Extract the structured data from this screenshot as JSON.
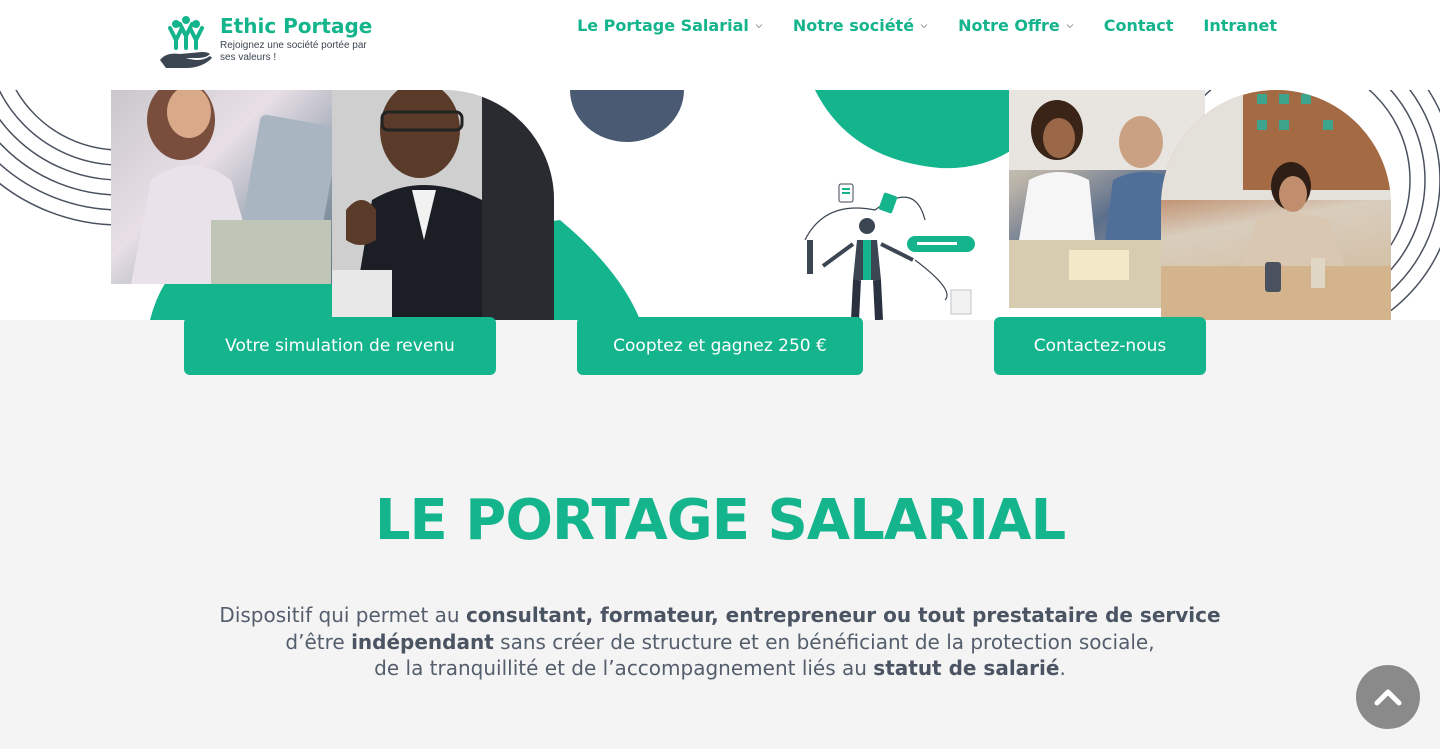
{
  "brand": {
    "name": "Ethic Portage",
    "tagline": "Rejoignez une société portée par ses valeurs !",
    "accent": "#14b48c",
    "dark": "#3c4652"
  },
  "nav": {
    "items": [
      {
        "label": "Le Portage Salarial",
        "has_dropdown": true
      },
      {
        "label": "Notre société",
        "has_dropdown": true
      },
      {
        "label": "Notre Offre",
        "has_dropdown": true
      },
      {
        "label": "Contact",
        "has_dropdown": false
      },
      {
        "label": "Intranet",
        "has_dropdown": false
      }
    ]
  },
  "cta": {
    "simulation": "Votre simulation de revenu",
    "cooptation": "Cooptez et gagnez 250 €",
    "contact": "Contactez-nous"
  },
  "section": {
    "title": "LE PORTAGE SALARIAL",
    "desc": {
      "l1_a": "Dispositif qui permet au ",
      "l1_b": "consultant, formateur, entrepreneur ou tout prestataire de service",
      "l2_a": "d’être ",
      "l2_b": "indépendant",
      "l2_c": " sans créer de structure et en bénéficiant de la protection sociale,",
      "l3_a": "de la tranquillité et de l’accompagnement liés au ",
      "l3_b": "statut de salarié",
      "l3_c": "."
    }
  },
  "icons": {
    "dropdown": "chevron-down-icon",
    "scroll_top": "chevron-up-icon",
    "logo": "people-hand-logo"
  }
}
